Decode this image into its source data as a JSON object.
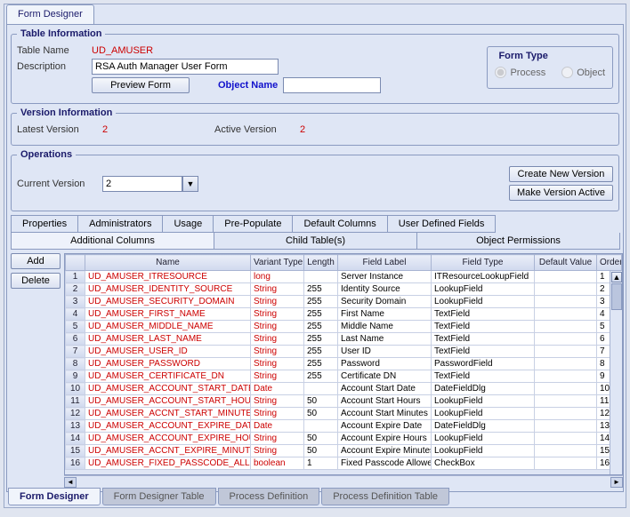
{
  "top_tab": "Form Designer",
  "table_info": {
    "legend": "Table Information",
    "table_name_lbl": "Table Name",
    "table_name_val": "UD_AMUSER",
    "desc_lbl": "Description",
    "desc_val": "RSA Auth Manager User Form",
    "preview_btn": "Preview Form",
    "object_name_lbl": "Object Name",
    "object_name_val": "",
    "form_type_legend": "Form Type",
    "form_type_process": "Process",
    "form_type_object": "Object"
  },
  "version_info": {
    "legend": "Version Information",
    "latest_lbl": "Latest Version",
    "latest_val": "2",
    "active_lbl": "Active Version",
    "active_val": "2"
  },
  "operations": {
    "legend": "Operations",
    "current_lbl": "Current Version",
    "current_val": "2",
    "create_btn": "Create New Version",
    "make_active_btn": "Make Version Active"
  },
  "subtabs1": [
    "Properties",
    "Administrators",
    "Usage",
    "Pre-Populate",
    "Default Columns",
    "User Defined Fields"
  ],
  "subtabs2": [
    "Additional Columns",
    "Child Table(s)",
    "Object Permissions"
  ],
  "subtabs2_active": 0,
  "grid_btns": {
    "add": "Add",
    "delete": "Delete"
  },
  "grid": {
    "headers": [
      "",
      "Name",
      "Variant Type",
      "Length",
      "Field Label",
      "Field Type",
      "Default Value",
      "Order"
    ],
    "col_interactive": [
      false,
      true,
      true,
      false,
      false,
      true,
      false,
      true
    ],
    "rows": [
      {
        "n": 1,
        "name": "UD_AMUSER_ITRESOURCE",
        "vt": "long",
        "len": "",
        "label": "Server Instance",
        "ft": "ITResourceLookupField",
        "dv": "",
        "ord": "1"
      },
      {
        "n": 2,
        "name": "UD_AMUSER_IDENTITY_SOURCE",
        "vt": "String",
        "len": "255",
        "label": "Identity Source",
        "ft": "LookupField",
        "dv": "",
        "ord": "2"
      },
      {
        "n": 3,
        "name": "UD_AMUSER_SECURITY_DOMAIN",
        "vt": "String",
        "len": "255",
        "label": "Security Domain",
        "ft": "LookupField",
        "dv": "",
        "ord": "3"
      },
      {
        "n": 4,
        "name": "UD_AMUSER_FIRST_NAME",
        "vt": "String",
        "len": "255",
        "label": "First Name",
        "ft": "TextField",
        "dv": "",
        "ord": "4"
      },
      {
        "n": 5,
        "name": "UD_AMUSER_MIDDLE_NAME",
        "vt": "String",
        "len": "255",
        "label": "Middle Name",
        "ft": "TextField",
        "dv": "",
        "ord": "5"
      },
      {
        "n": 6,
        "name": "UD_AMUSER_LAST_NAME",
        "vt": "String",
        "len": "255",
        "label": "Last Name",
        "ft": "TextField",
        "dv": "",
        "ord": "6"
      },
      {
        "n": 7,
        "name": "UD_AMUSER_USER_ID",
        "vt": "String",
        "len": "255",
        "label": "User ID",
        "ft": "TextField",
        "dv": "",
        "ord": "7"
      },
      {
        "n": 8,
        "name": "UD_AMUSER_PASSWORD",
        "vt": "String",
        "len": "255",
        "label": "Password",
        "ft": "PasswordField",
        "dv": "",
        "ord": "8"
      },
      {
        "n": 9,
        "name": "UD_AMUSER_CERTIFICATE_DN",
        "vt": "String",
        "len": "255",
        "label": "Certificate DN",
        "ft": "TextField",
        "dv": "",
        "ord": "9"
      },
      {
        "n": 10,
        "name": "UD_AMUSER_ACCOUNT_START_DATE",
        "vt": "Date",
        "len": "",
        "label": "Account Start Date",
        "ft": "DateFieldDlg",
        "dv": "",
        "ord": "10"
      },
      {
        "n": 11,
        "name": "UD_AMUSER_ACCOUNT_START_HOURS",
        "vt": "String",
        "len": "50",
        "label": "Account Start Hours",
        "ft": "LookupField",
        "dv": "",
        "ord": "11"
      },
      {
        "n": 12,
        "name": "UD_AMUSER_ACCNT_START_MINUTES",
        "vt": "String",
        "len": "50",
        "label": "Account Start Minutes",
        "ft": "LookupField",
        "dv": "",
        "ord": "12"
      },
      {
        "n": 13,
        "name": "UD_AMUSER_ACCOUNT_EXPIRE_DATE",
        "vt": "Date",
        "len": "",
        "label": "Account Expire Date",
        "ft": "DateFieldDlg",
        "dv": "",
        "ord": "13"
      },
      {
        "n": 14,
        "name": "UD_AMUSER_ACCOUNT_EXPIRE_HOURS",
        "vt": "String",
        "len": "50",
        "label": "Account Expire Hours",
        "ft": "LookupField",
        "dv": "",
        "ord": "14"
      },
      {
        "n": 15,
        "name": "UD_AMUSER_ACCNT_EXPIRE_MINUTES",
        "vt": "String",
        "len": "50",
        "label": "Account Expire Minutes",
        "ft": "LookupField",
        "dv": "",
        "ord": "15"
      },
      {
        "n": 16,
        "name": "UD_AMUSER_FIXED_PASSCODE_ALLOW",
        "vt": "boolean",
        "len": "1",
        "label": "Fixed Passcode Allowed",
        "ft": "CheckBox",
        "dv": "",
        "ord": "16"
      }
    ]
  },
  "bottom_tabs": [
    "Form Designer",
    "Form Designer Table",
    "Process Definition",
    "Process Definition Table"
  ],
  "bottom_active": 0
}
